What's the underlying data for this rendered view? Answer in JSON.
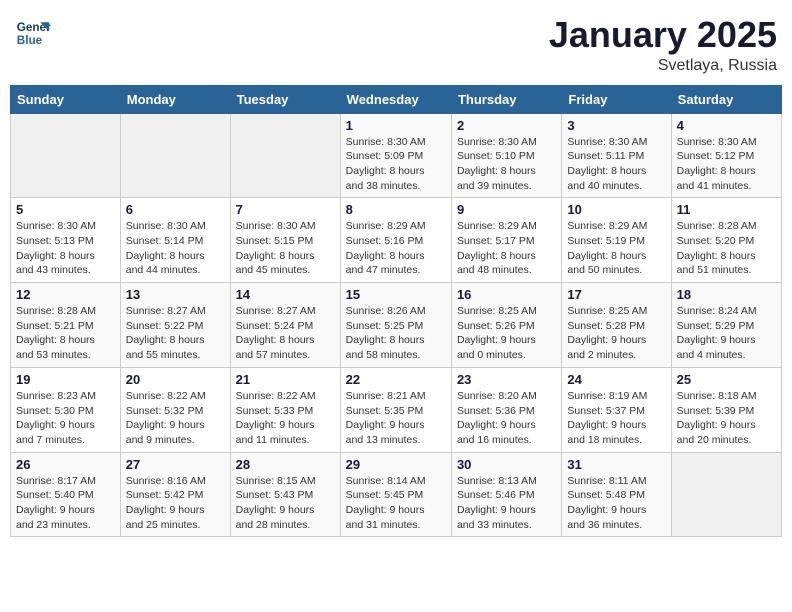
{
  "header": {
    "logo_line1": "General",
    "logo_line2": "Blue",
    "month": "January 2025",
    "location": "Svetlaya, Russia"
  },
  "weekdays": [
    "Sunday",
    "Monday",
    "Tuesday",
    "Wednesday",
    "Thursday",
    "Friday",
    "Saturday"
  ],
  "weeks": [
    [
      {
        "day": "",
        "info": ""
      },
      {
        "day": "",
        "info": ""
      },
      {
        "day": "",
        "info": ""
      },
      {
        "day": "1",
        "info": "Sunrise: 8:30 AM\nSunset: 5:09 PM\nDaylight: 8 hours\nand 38 minutes."
      },
      {
        "day": "2",
        "info": "Sunrise: 8:30 AM\nSunset: 5:10 PM\nDaylight: 8 hours\nand 39 minutes."
      },
      {
        "day": "3",
        "info": "Sunrise: 8:30 AM\nSunset: 5:11 PM\nDaylight: 8 hours\nand 40 minutes."
      },
      {
        "day": "4",
        "info": "Sunrise: 8:30 AM\nSunset: 5:12 PM\nDaylight: 8 hours\nand 41 minutes."
      }
    ],
    [
      {
        "day": "5",
        "info": "Sunrise: 8:30 AM\nSunset: 5:13 PM\nDaylight: 8 hours\nand 43 minutes."
      },
      {
        "day": "6",
        "info": "Sunrise: 8:30 AM\nSunset: 5:14 PM\nDaylight: 8 hours\nand 44 minutes."
      },
      {
        "day": "7",
        "info": "Sunrise: 8:30 AM\nSunset: 5:15 PM\nDaylight: 8 hours\nand 45 minutes."
      },
      {
        "day": "8",
        "info": "Sunrise: 8:29 AM\nSunset: 5:16 PM\nDaylight: 8 hours\nand 47 minutes."
      },
      {
        "day": "9",
        "info": "Sunrise: 8:29 AM\nSunset: 5:17 PM\nDaylight: 8 hours\nand 48 minutes."
      },
      {
        "day": "10",
        "info": "Sunrise: 8:29 AM\nSunset: 5:19 PM\nDaylight: 8 hours\nand 50 minutes."
      },
      {
        "day": "11",
        "info": "Sunrise: 8:28 AM\nSunset: 5:20 PM\nDaylight: 8 hours\nand 51 minutes."
      }
    ],
    [
      {
        "day": "12",
        "info": "Sunrise: 8:28 AM\nSunset: 5:21 PM\nDaylight: 8 hours\nand 53 minutes."
      },
      {
        "day": "13",
        "info": "Sunrise: 8:27 AM\nSunset: 5:22 PM\nDaylight: 8 hours\nand 55 minutes."
      },
      {
        "day": "14",
        "info": "Sunrise: 8:27 AM\nSunset: 5:24 PM\nDaylight: 8 hours\nand 57 minutes."
      },
      {
        "day": "15",
        "info": "Sunrise: 8:26 AM\nSunset: 5:25 PM\nDaylight: 8 hours\nand 58 minutes."
      },
      {
        "day": "16",
        "info": "Sunrise: 8:25 AM\nSunset: 5:26 PM\nDaylight: 9 hours\nand 0 minutes."
      },
      {
        "day": "17",
        "info": "Sunrise: 8:25 AM\nSunset: 5:28 PM\nDaylight: 9 hours\nand 2 minutes."
      },
      {
        "day": "18",
        "info": "Sunrise: 8:24 AM\nSunset: 5:29 PM\nDaylight: 9 hours\nand 4 minutes."
      }
    ],
    [
      {
        "day": "19",
        "info": "Sunrise: 8:23 AM\nSunset: 5:30 PM\nDaylight: 9 hours\nand 7 minutes."
      },
      {
        "day": "20",
        "info": "Sunrise: 8:22 AM\nSunset: 5:32 PM\nDaylight: 9 hours\nand 9 minutes."
      },
      {
        "day": "21",
        "info": "Sunrise: 8:22 AM\nSunset: 5:33 PM\nDaylight: 9 hours\nand 11 minutes."
      },
      {
        "day": "22",
        "info": "Sunrise: 8:21 AM\nSunset: 5:35 PM\nDaylight: 9 hours\nand 13 minutes."
      },
      {
        "day": "23",
        "info": "Sunrise: 8:20 AM\nSunset: 5:36 PM\nDaylight: 9 hours\nand 16 minutes."
      },
      {
        "day": "24",
        "info": "Sunrise: 8:19 AM\nSunset: 5:37 PM\nDaylight: 9 hours\nand 18 minutes."
      },
      {
        "day": "25",
        "info": "Sunrise: 8:18 AM\nSunset: 5:39 PM\nDaylight: 9 hours\nand 20 minutes."
      }
    ],
    [
      {
        "day": "26",
        "info": "Sunrise: 8:17 AM\nSunset: 5:40 PM\nDaylight: 9 hours\nand 23 minutes."
      },
      {
        "day": "27",
        "info": "Sunrise: 8:16 AM\nSunset: 5:42 PM\nDaylight: 9 hours\nand 25 minutes."
      },
      {
        "day": "28",
        "info": "Sunrise: 8:15 AM\nSunset: 5:43 PM\nDaylight: 9 hours\nand 28 minutes."
      },
      {
        "day": "29",
        "info": "Sunrise: 8:14 AM\nSunset: 5:45 PM\nDaylight: 9 hours\nand 31 minutes."
      },
      {
        "day": "30",
        "info": "Sunrise: 8:13 AM\nSunset: 5:46 PM\nDaylight: 9 hours\nand 33 minutes."
      },
      {
        "day": "31",
        "info": "Sunrise: 8:11 AM\nSunset: 5:48 PM\nDaylight: 9 hours\nand 36 minutes."
      },
      {
        "day": "",
        "info": ""
      }
    ]
  ]
}
